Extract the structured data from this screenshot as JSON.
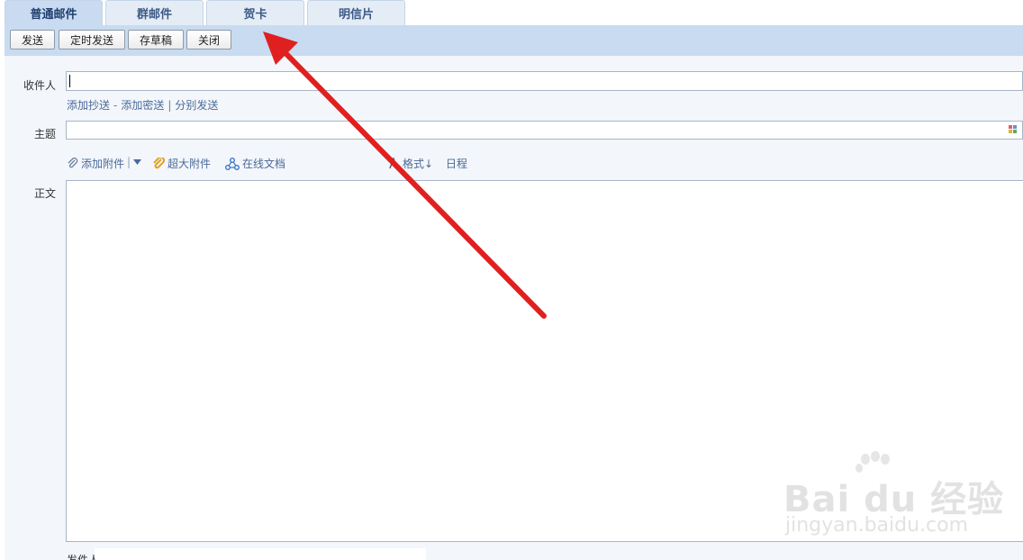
{
  "tabs": [
    {
      "label": "普通邮件"
    },
    {
      "label": "群邮件"
    },
    {
      "label": "贺卡"
    },
    {
      "label": "明信片"
    }
  ],
  "toolbar": {
    "send": "发送",
    "scheduled_send": "定时发送",
    "save_draft": "存草稿",
    "close": "关闭"
  },
  "compose": {
    "to_label": "收件人",
    "add_cc": "添加抄送",
    "add_bcc": "添加密送",
    "separate_send": "分别发送",
    "subject_label": "主题",
    "add_attachment": "添加附件",
    "large_attachment": "超大附件",
    "online_doc": "在线文档",
    "format": "格式↓",
    "schedule": "日程",
    "body_label": "正文",
    "sender_label": "发件人"
  },
  "watermark": {
    "brand": "Bai du 经验",
    "url": "jingyan.baidu.com"
  },
  "colors": {
    "toolbar_bg": "#c8dbf1",
    "link": "#4a6a9a",
    "arrow": "#e02020"
  },
  "icons": [
    "paperclip-icon",
    "chevron-down-icon",
    "large-attachment-icon",
    "online-doc-icon",
    "format-icon",
    "grid-icon"
  ]
}
